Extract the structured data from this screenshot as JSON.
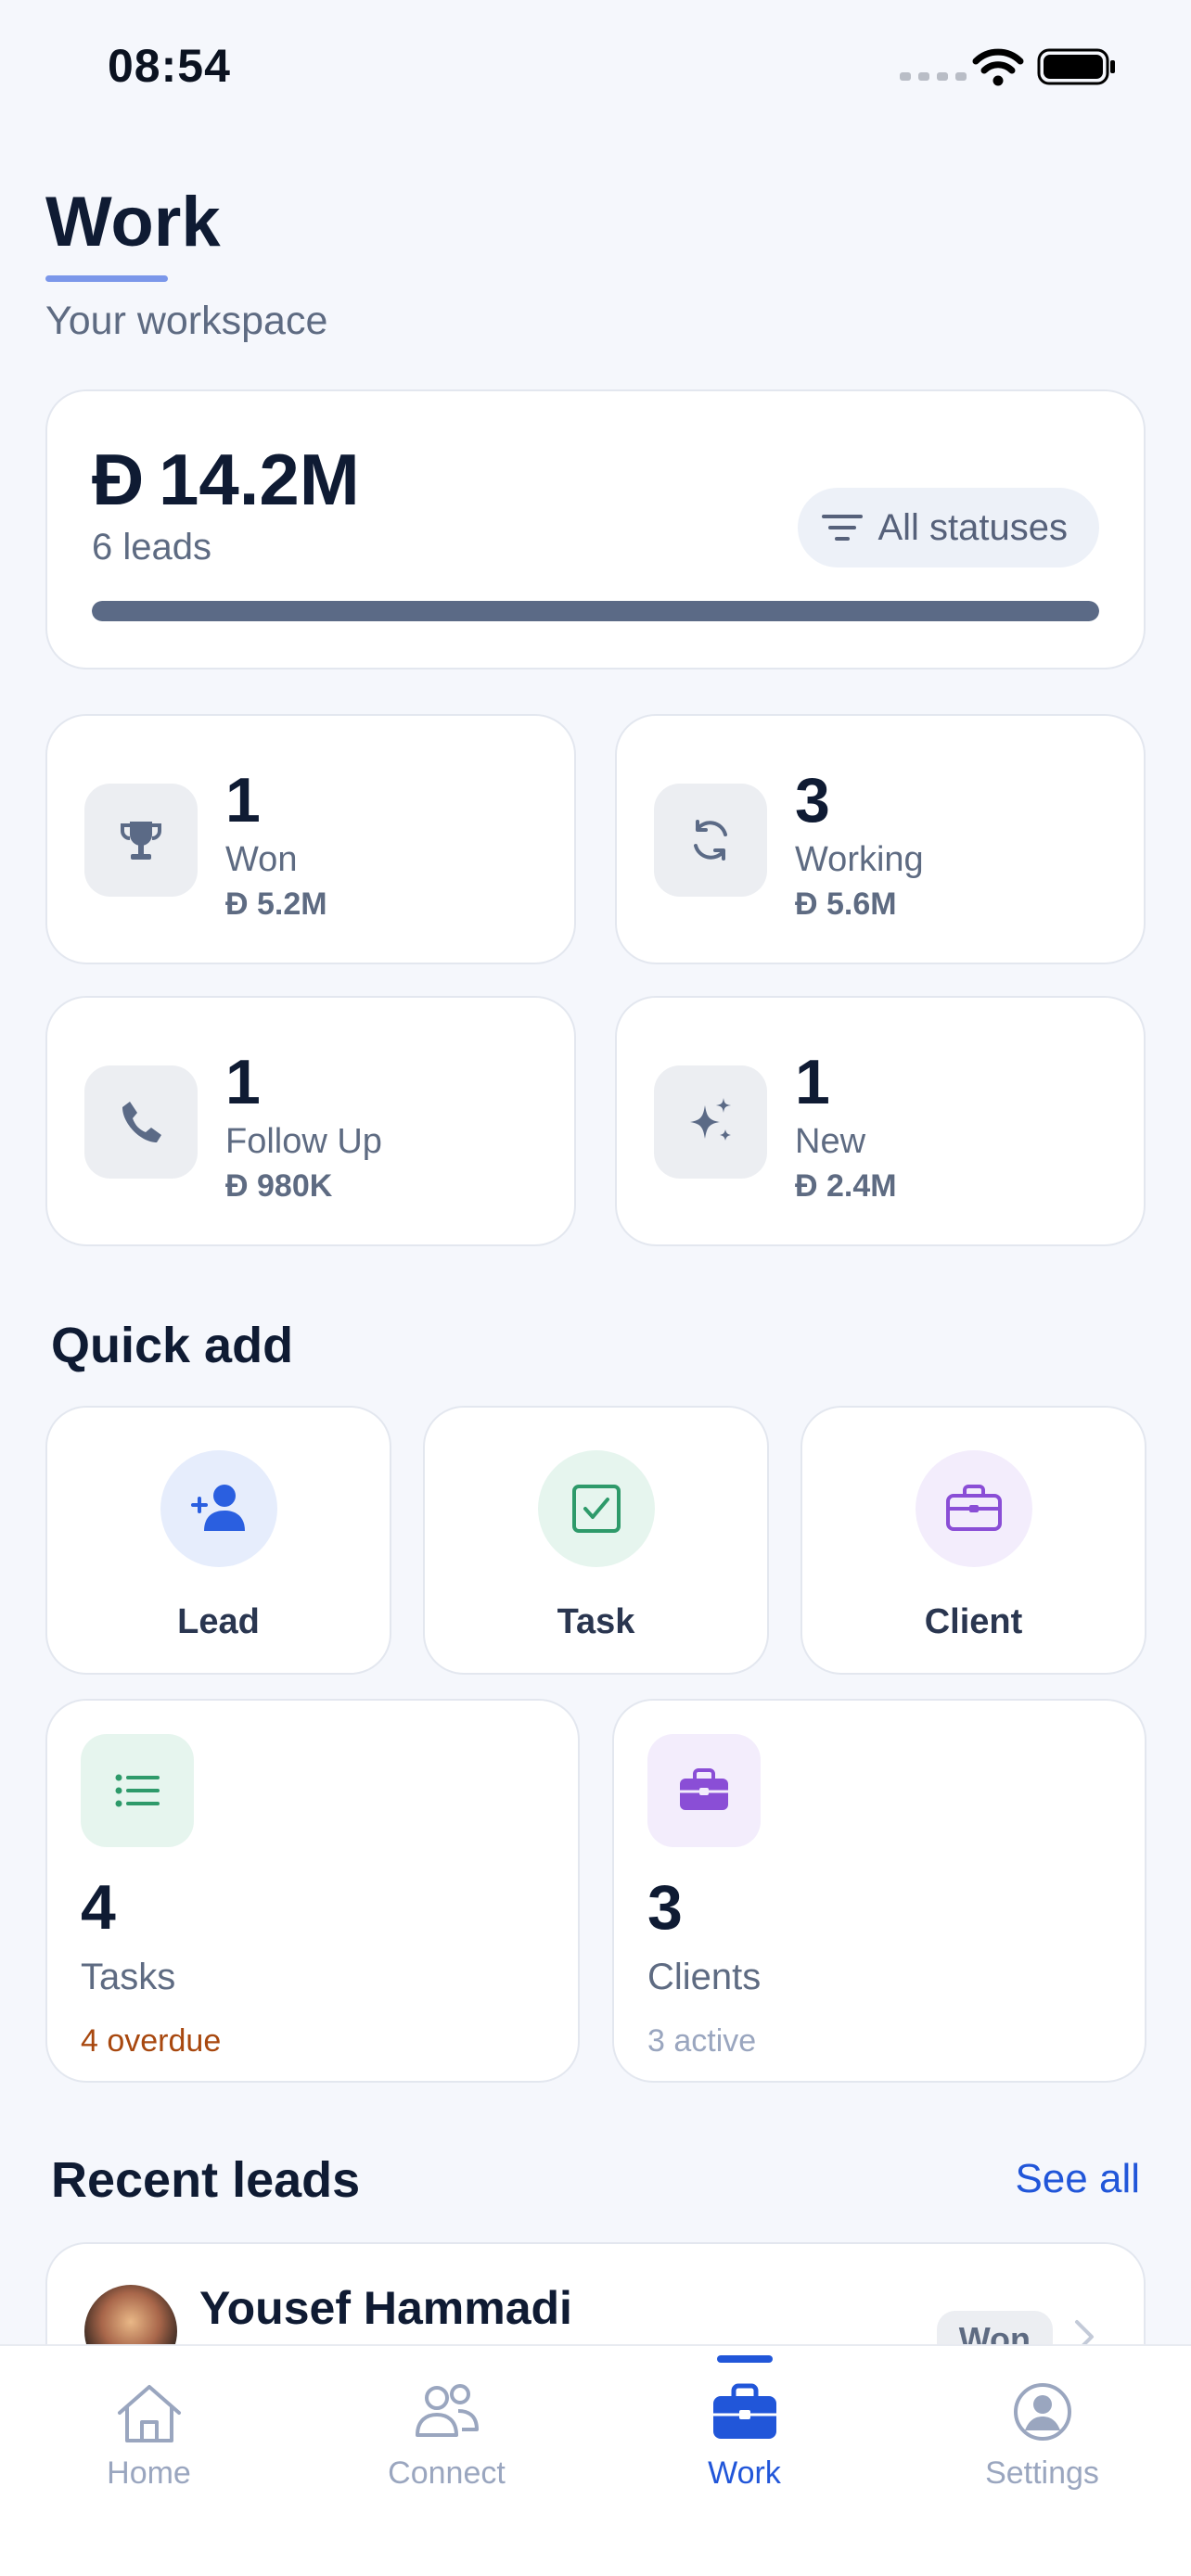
{
  "status_bar": {
    "time": "08:54"
  },
  "header": {
    "title": "Work",
    "subtitle": "Your workspace"
  },
  "summary": {
    "amount": "Đ 14.2M",
    "leads_count": "6 leads",
    "filter_label": "All statuses",
    "filter_icon": "filter-icon",
    "progress": 1.0
  },
  "stats": [
    {
      "icon": "trophy-icon",
      "count": "1",
      "label": "Won",
      "value": "Đ 5.2M"
    },
    {
      "icon": "refresh-icon",
      "count": "3",
      "label": "Working",
      "value": "Đ 5.6M"
    },
    {
      "icon": "phone-icon",
      "count": "1",
      "label": "Follow Up",
      "value": "Đ 980K"
    },
    {
      "icon": "sparkles-icon",
      "count": "1",
      "label": "New",
      "value": "Đ 2.4M"
    }
  ],
  "quick_add": {
    "title": "Quick add",
    "items": [
      {
        "icon": "add-person-icon",
        "label": "Lead",
        "color": "#2a5fe0"
      },
      {
        "icon": "checkbox-icon",
        "label": "Task",
        "color": "#2e9a6a"
      },
      {
        "icon": "briefcase-icon",
        "label": "Client",
        "color": "#8a4ed6"
      }
    ]
  },
  "tasks": {
    "icon": "list-icon",
    "count": "4",
    "label": "Tasks",
    "sub": "4 overdue",
    "sub_color": "#a8480f"
  },
  "clients": {
    "icon": "briefcase-icon",
    "count": "3",
    "label": "Clients",
    "sub": "3 active",
    "sub_color": "#9aa6bf"
  },
  "recent_leads": {
    "title": "Recent leads",
    "see_all": "See all",
    "items": [
      {
        "name": "Yousef Hammadi",
        "status": "Won"
      }
    ]
  },
  "tab_bar": {
    "tabs": [
      {
        "label": "Home",
        "icon": "home-icon"
      },
      {
        "label": "Connect",
        "icon": "people-icon"
      },
      {
        "label": "Work",
        "icon": "briefcase-icon",
        "active": true
      },
      {
        "label": "Settings",
        "icon": "user-circle-icon"
      }
    ]
  },
  "colors": {
    "accent": "#2156d9",
    "background": "#f5f7fc",
    "text": "#0f1b33"
  }
}
